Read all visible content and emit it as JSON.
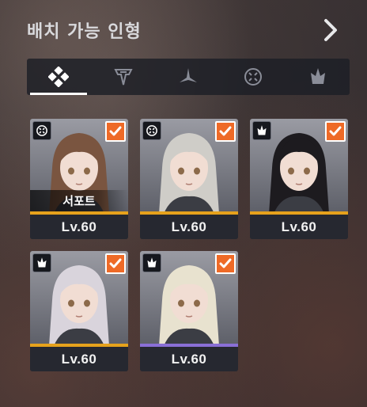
{
  "header": {
    "title": "배치 가능 인형"
  },
  "filter_tabs": [
    {
      "icon": "all-diamond-icon",
      "active": true
    },
    {
      "icon": "vanguard-class-icon",
      "active": false
    },
    {
      "icon": "sentinel-class-icon",
      "active": false
    },
    {
      "icon": "support-class-icon",
      "active": false
    },
    {
      "icon": "bulwark-class-icon",
      "active": false
    }
  ],
  "dolls": [
    {
      "level": "Lv.60",
      "class_icon": "support-class-icon",
      "checked": true,
      "tag": "서포트",
      "hair": "#7a5540",
      "bar_color": "#e6a21c"
    },
    {
      "level": "Lv.60",
      "class_icon": "support-class-icon",
      "checked": true,
      "tag": "",
      "hair": "#cfcdc8",
      "bar_color": "#e6a21c"
    },
    {
      "level": "Lv.60",
      "class_icon": "bulwark-class-icon",
      "checked": true,
      "tag": "",
      "hair": "#1d1b1f",
      "bar_color": "#e6a21c"
    },
    {
      "level": "Lv.60",
      "class_icon": "bulwark-class-icon",
      "checked": true,
      "tag": "",
      "hair": "#d9d4dc",
      "bar_color": "#e6a21c"
    },
    {
      "level": "Lv.60",
      "class_icon": "bulwark-class-icon",
      "checked": true,
      "tag": "",
      "hair": "#e8e2cf",
      "bar_color": "#8a6fd6"
    }
  ]
}
